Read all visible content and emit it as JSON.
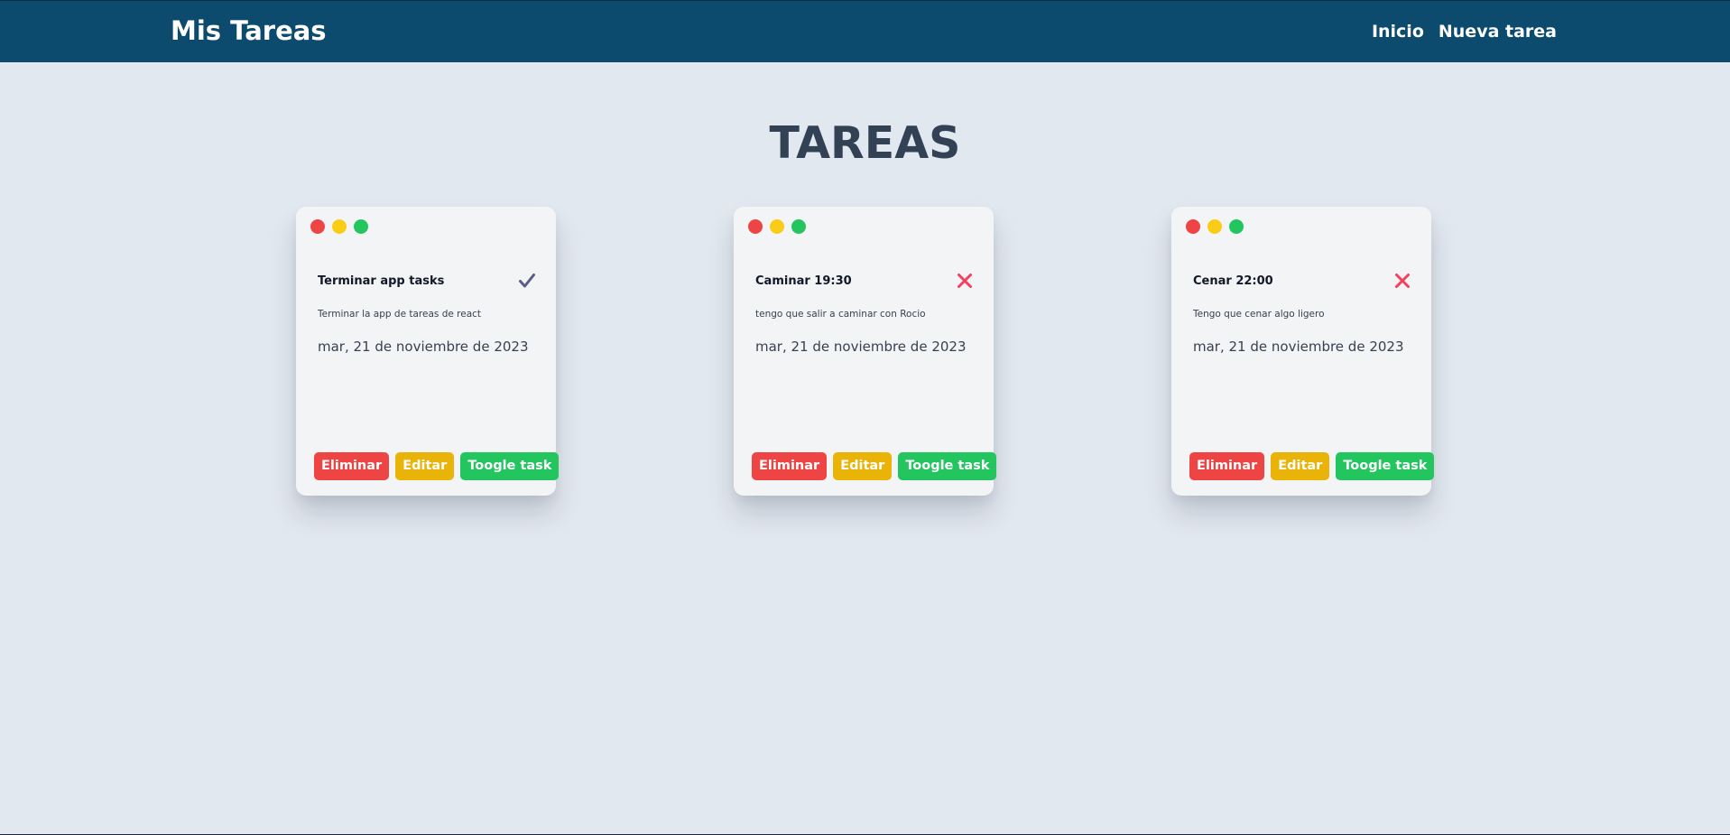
{
  "navbar": {
    "brand": "Mis Tareas",
    "links": [
      "Inicio",
      "Nueva tarea"
    ]
  },
  "main": {
    "title": "TAREAS"
  },
  "tasks": [
    {
      "title": "Terminar app tasks",
      "description": "Terminar la app de tareas de react",
      "date": "mar, 21 de noviembre de 2023",
      "done": true,
      "status_icon": "check-icon"
    },
    {
      "title": "Caminar 19:30",
      "description": "tengo que salir a caminar con Rocio",
      "date": "mar, 21 de noviembre de 2023",
      "done": false,
      "status_icon": "x-icon"
    },
    {
      "title": "Cenar 22:00",
      "description": "Tengo que cenar algo ligero",
      "date": "mar, 21 de noviembre de 2023",
      "done": false,
      "status_icon": "x-icon"
    }
  ],
  "buttons": {
    "delete_label": "Eliminar",
    "edit_label": "Editar",
    "toggle_label": "Toogle task"
  },
  "colors": {
    "navbar": "#0c4a6e",
    "background": "#e2e8f0",
    "card": "#f3f4f6",
    "delete": "#ef4444",
    "edit": "#eab308",
    "toggle": "#22c55e",
    "check": "#5b5b8c",
    "cross": "#f43f5e"
  }
}
